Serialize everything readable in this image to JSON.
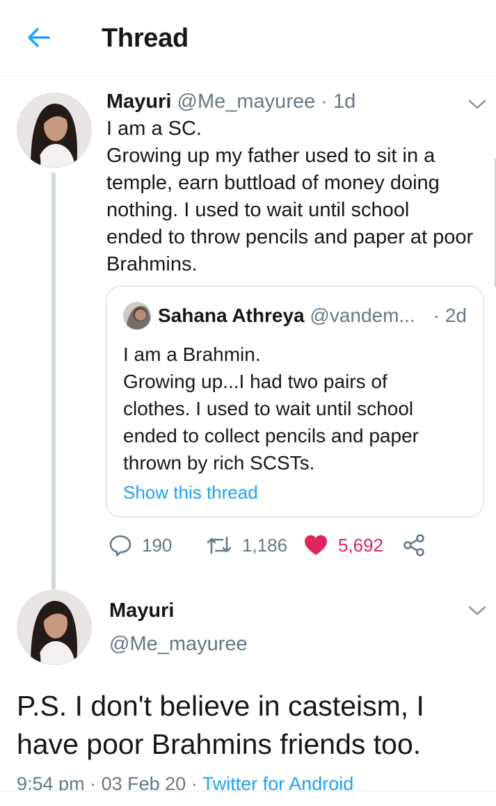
{
  "header": {
    "title": "Thread",
    "back_icon": "arrow-left-icon",
    "accent": "#1da1f2"
  },
  "tweet1": {
    "name": "Mayuri",
    "handle": "@Me_mayuree",
    "time": "1d",
    "lines": [
      "I am a SC.",
      "Growing up my father used to sit in a",
      "temple, earn buttload of money doing",
      "nothing. I used to wait until school",
      "ended to throw pencils and paper at poor",
      "Brahmins."
    ],
    "quote": {
      "name": "Sahana Athreya",
      "handle": "@vandem...",
      "time": "2d",
      "lines": [
        "I am a Brahmin.",
        "Growing up...I had two pairs of",
        "clothes. I used to wait until school",
        "ended to collect pencils and paper",
        "thrown by rich SCSTs."
      ],
      "show_thread": "Show this thread"
    },
    "actions": {
      "replies": "190",
      "retweets": "1,186",
      "likes": "5,692",
      "like_color": "#e0245e"
    }
  },
  "tweet2": {
    "name": "Mayuri",
    "handle": "@Me_mayuree",
    "lines": [
      "P.S. I don't believe in casteism, I",
      "have poor Brahmins friends too."
    ],
    "time": "9:54 pm",
    "date": "03 Feb 20",
    "source": "Twitter for Android"
  }
}
